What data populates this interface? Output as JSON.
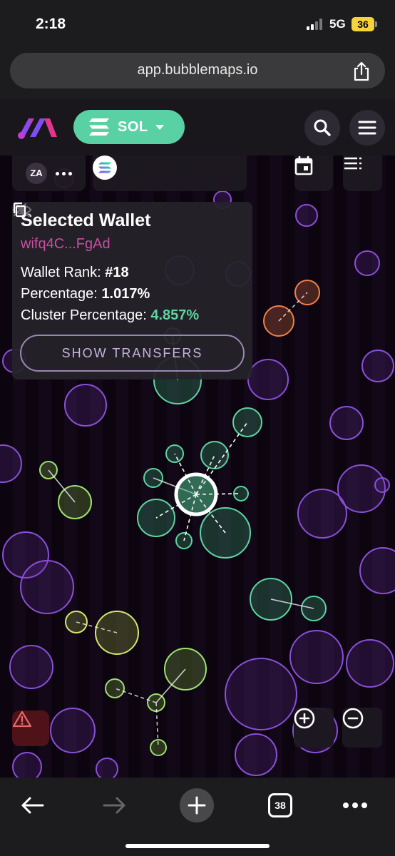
{
  "status": {
    "time": "2:18",
    "network": "5G",
    "battery": "36"
  },
  "browser": {
    "url": "app.bubblemaps.io",
    "tab_count": "38"
  },
  "header": {
    "chain_label": "SOL"
  },
  "toolbar": {
    "avatar_initials": "ZA"
  },
  "wallet_panel": {
    "title": "Selected Wallet",
    "address": "wifq4C...FgAd",
    "rank_label": "Wallet Rank:",
    "rank_value": "#18",
    "percentage_label": "Percentage:",
    "percentage_value": "1.017%",
    "cluster_label": "Cluster Percentage:",
    "cluster_value": "4.857%",
    "show_transfers_label": "SHOW TRANSFERS"
  },
  "colors": {
    "brand_green": "#5ad1a4",
    "address_pink": "#c94ea1",
    "cluster_green": "#5ed59f",
    "bubble_purple": "#8a4fd8",
    "bubble_teal": "#5fd3a0",
    "bubble_lime": "#9ee070",
    "bubble_yellow": "#d6e56c",
    "bubble_orange": "#f0804a"
  },
  "icons": [
    "bubblemaps-logo",
    "solana-icon",
    "search-icon",
    "menu-icon",
    "question-icon",
    "gear-icon",
    "solana-token-icon",
    "calendar-icon",
    "list-icon",
    "eye-off-icon",
    "close-icon",
    "copy-icon",
    "warning-icon",
    "zoom-in-icon",
    "zoom-out-icon",
    "back-icon",
    "forward-icon",
    "new-tab-icon",
    "more-icon",
    "share-icon"
  ]
}
